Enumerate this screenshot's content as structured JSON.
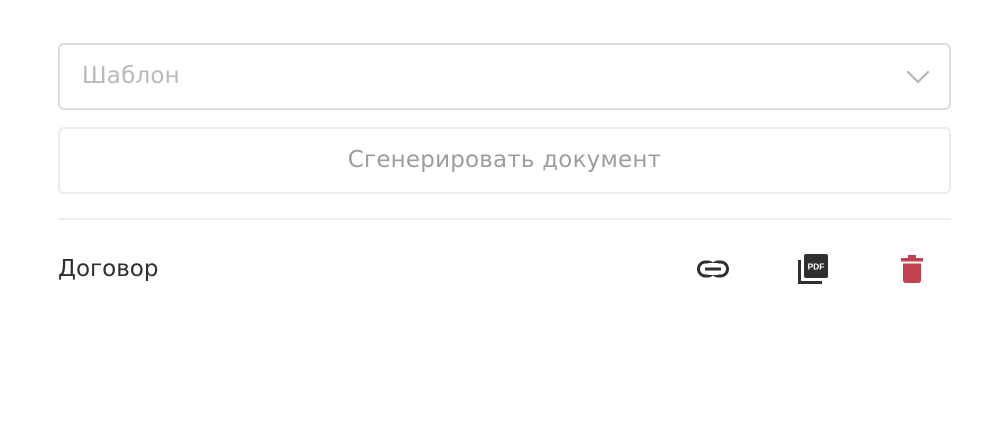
{
  "template_select": {
    "placeholder": "Шаблон",
    "icon": "chevron-down-icon"
  },
  "generate_button": {
    "label": "Сгенерировать документ"
  },
  "documents": [
    {
      "name": "Договор",
      "actions": [
        {
          "icon": "link-icon"
        },
        {
          "icon": "pdf-icon"
        },
        {
          "icon": "trash-icon",
          "color": "#c4404f"
        }
      ]
    }
  ],
  "colors": {
    "placeholder_text": "#b9b9b9",
    "button_text": "#9d9d9d",
    "doc_text": "#2f2f2f",
    "icon_dark": "#2f2f2f",
    "danger": "#c4404f",
    "border": "#dcdcdc"
  }
}
